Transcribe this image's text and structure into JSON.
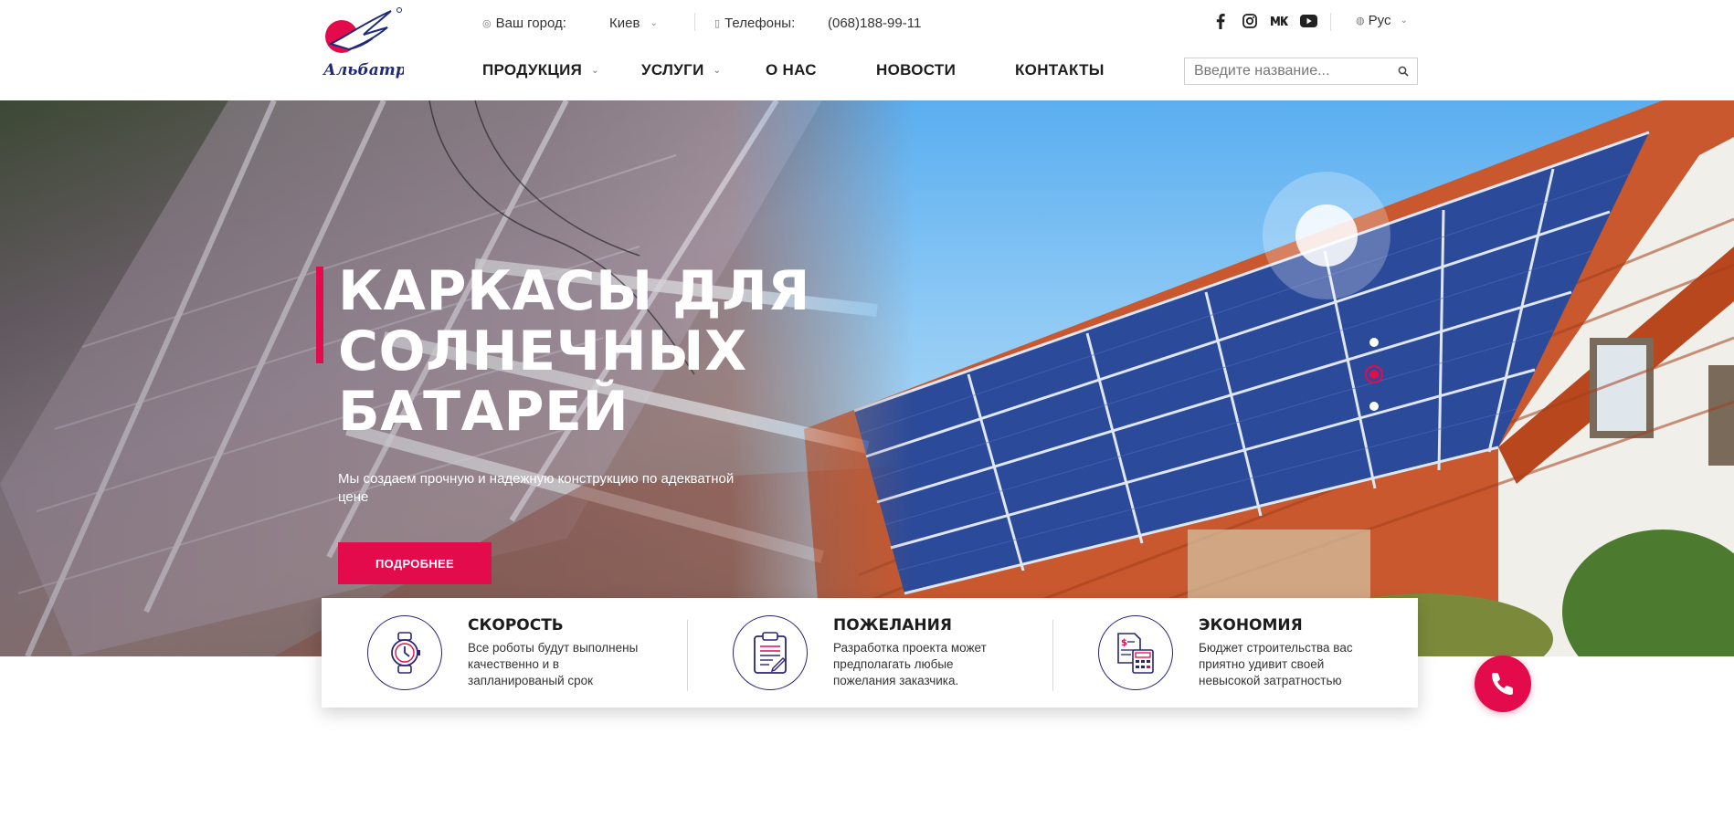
{
  "header": {
    "logo_text": "Альбатрос",
    "city_label": "Ваш город:",
    "city_value": "Киев",
    "phones_label": "Телефоны:",
    "phone_value": "(068)188-99-11",
    "socials": [
      "facebook-icon",
      "instagram-icon",
      "vk-icon",
      "youtube-icon"
    ],
    "language": "Рус",
    "nav": [
      {
        "label": "ПРОДУКЦИЯ",
        "has_dropdown": true
      },
      {
        "label": "УСЛУГИ",
        "has_dropdown": true
      },
      {
        "label": "О НАС",
        "has_dropdown": false
      },
      {
        "label": "НОВОСТИ",
        "has_dropdown": false
      },
      {
        "label": "КОНТАКТЫ",
        "has_dropdown": false
      }
    ],
    "search": {
      "placeholder": "Введите название..."
    }
  },
  "hero": {
    "title": "КАРКАСЫ ДЛЯ СОЛНЕЧНЫХ БАТАРЕЙ",
    "subtitle": "Мы создаем прочную и надежную конструкцию по адекватной цене",
    "button_label": "ПОДРОБНЕЕ",
    "slide_count": 3,
    "active_slide": 2
  },
  "features": [
    {
      "title": "СКОРОСТЬ",
      "description": "Все роботы будут выполнены качественно и в запланированый срок",
      "icon": "watch-icon"
    },
    {
      "title": "ПОЖЕЛАНИЯ",
      "description": "Разработка проекта может предполагать любые пожелания заказчика.",
      "icon": "clipboard-icon"
    },
    {
      "title": "ЭКОНОМИЯ",
      "description": "Бюджет строительства вас приятно удивит своей невысокой затратностью",
      "icon": "calculator-icon"
    }
  ],
  "colors": {
    "accent": "#e30b4b",
    "icon_stroke": "#2a2673",
    "roof": "#d9562a",
    "panel": "#2c4a9a"
  }
}
